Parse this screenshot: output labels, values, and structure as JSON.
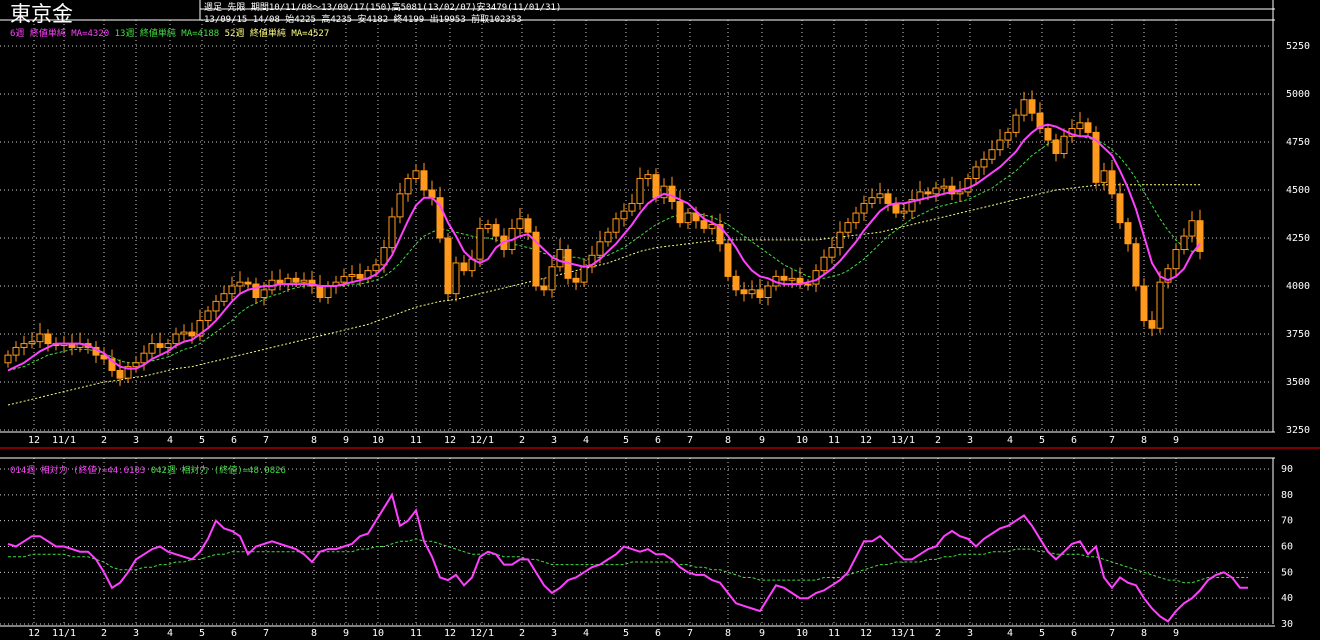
{
  "header": {
    "symbol": "東京金",
    "line1": "週足  先限  期間10/11/08～13/09/17(150)高5081(13/02/07)安3479(11/01/31)",
    "line2": "13/09/15 14/08 始4225 高4235 安4182 終4199 出19953 前取102353"
  },
  "legend_top": [
    {
      "text": "6週 終値単純 MA=4320",
      "color": "#ff40ff"
    },
    {
      "text": "13週 終値単純 MA=4188",
      "color": "#40e040"
    },
    {
      "text": "52週 終値単純 MA=4527",
      "color": "#ffff80"
    }
  ],
  "legend_bottom": [
    {
      "text": "014週 相対力 (終値)=44.6103",
      "color": "#ff40ff"
    },
    {
      "text": "042週 相対力 (終値)=48.0826",
      "color": "#40e040"
    }
  ],
  "colors": {
    "background": "#000000",
    "grid": "#ffffff",
    "candle_up": "#000000",
    "candle_up_border": "#ff9a1c",
    "candle_down": "#ff9a1c",
    "ma6": "#ff40ff",
    "ma13": "#40e040",
    "ma52": "#ffff80",
    "rsi14": "#ff40ff",
    "rsi42": "#40e040",
    "separator": "#ff0000"
  },
  "chart_data": [
    {
      "type": "candlestick",
      "title": "東京金",
      "ylim": [
        3250,
        5250
      ],
      "yticks": [
        3250,
        3500,
        3750,
        4000,
        4250,
        4500,
        4750,
        5000,
        5250
      ],
      "xticks": [
        "12",
        "11/1",
        "2",
        "3",
        "4",
        "5",
        "6",
        "7",
        "8",
        "9",
        "10",
        "11",
        "12",
        "12/1",
        "2",
        "3",
        "4",
        "5",
        "6",
        "7",
        "8",
        "9",
        "10",
        "11",
        "12",
        "13/1",
        "2",
        "3",
        "4",
        "5",
        "6",
        "7",
        "8",
        "9"
      ],
      "n_weeks": 150,
      "close": [
        3640,
        3680,
        3700,
        3710,
        3750,
        3700,
        3690,
        3700,
        3680,
        3700,
        3680,
        3640,
        3620,
        3560,
        3520,
        3580,
        3600,
        3650,
        3700,
        3680,
        3700,
        3750,
        3760,
        3740,
        3820,
        3870,
        3920,
        3960,
        4000,
        4020,
        4010,
        3940,
        3980,
        4030,
        4010,
        4040,
        4020,
        4030,
        4000,
        3940,
        4000,
        4020,
        4050,
        4060,
        4040,
        4080,
        4110,
        4200,
        4360,
        4480,
        4560,
        4600,
        4500,
        4460,
        4250,
        3960,
        4120,
        4080,
        4140,
        4300,
        4320,
        4260,
        4190,
        4300,
        4350,
        4280,
        4000,
        3980,
        4100,
        4190,
        4040,
        4020,
        4100,
        4160,
        4230,
        4280,
        4350,
        4390,
        4430,
        4560,
        4580,
        4460,
        4520,
        4440,
        4330,
        4380,
        4340,
        4300,
        4320,
        4220,
        4050,
        3980,
        3960,
        3980,
        3940,
        4000,
        4050,
        4030,
        4040,
        4010,
        4010,
        4080,
        4150,
        4200,
        4280,
        4330,
        4380,
        4430,
        4460,
        4480,
        4430,
        4380,
        4390,
        4450,
        4490,
        4480,
        4510,
        4520,
        4480,
        4490,
        4560,
        4620,
        4660,
        4710,
        4760,
        4800,
        4890,
        4970,
        4900,
        4820,
        4760,
        4690,
        4780,
        4820,
        4850,
        4800,
        4540,
        4600,
        4480,
        4330,
        4220,
        4000,
        3820,
        3780,
        4020,
        4090,
        4190,
        4260,
        4340,
        4180
      ],
      "ma6": [
        3560,
        3580,
        3600,
        3630,
        3660,
        3680,
        3700,
        3700,
        3700,
        3700,
        3690,
        3670,
        3650,
        3610,
        3580,
        3570,
        3570,
        3590,
        3620,
        3640,
        3660,
        3690,
        3710,
        3720,
        3750,
        3780,
        3820,
        3870,
        3920,
        3960,
        3980,
        3990,
        4000,
        4000,
        4010,
        4010,
        4010,
        4010,
        4010,
        4000,
        4000,
        4000,
        4010,
        4020,
        4030,
        4040,
        4060,
        4100,
        4160,
        4250,
        4340,
        4420,
        4460,
        4460,
        4420,
        4330,
        4260,
        4180,
        4140,
        4120,
        4140,
        4200,
        4230,
        4240,
        4260,
        4270,
        4230,
        4190,
        4150,
        4130,
        4120,
        4110,
        4100,
        4110,
        4140,
        4180,
        4220,
        4270,
        4320,
        4380,
        4430,
        4460,
        4480,
        4470,
        4450,
        4430,
        4390,
        4350,
        4330,
        4310,
        4260,
        4200,
        4130,
        4080,
        4050,
        4040,
        4020,
        4010,
        4010,
        4010,
        4020,
        4030,
        4060,
        4090,
        4130,
        4180,
        4230,
        4290,
        4340,
        4390,
        4420,
        4430,
        4430,
        4440,
        4450,
        4460,
        4470,
        4480,
        4490,
        4500,
        4510,
        4530,
        4560,
        4590,
        4620,
        4660,
        4700,
        4760,
        4800,
        4830,
        4840,
        4830,
        4810,
        4790,
        4780,
        4780,
        4760,
        4720,
        4680,
        4600,
        4510,
        4400,
        4260,
        4120,
        4050,
        4030,
        4050,
        4090,
        4170,
        4220
      ],
      "ma13": [
        3560,
        3570,
        3580,
        3600,
        3620,
        3640,
        3650,
        3660,
        3670,
        3670,
        3670,
        3660,
        3650,
        3630,
        3610,
        3600,
        3600,
        3600,
        3610,
        3620,
        3630,
        3650,
        3670,
        3680,
        3700,
        3730,
        3760,
        3790,
        3820,
        3860,
        3890,
        3910,
        3930,
        3950,
        3960,
        3980,
        3990,
        4000,
        4000,
        4000,
        4000,
        4000,
        4000,
        4010,
        4010,
        4020,
        4030,
        4050,
        4080,
        4120,
        4170,
        4220,
        4260,
        4280,
        4300,
        4290,
        4280,
        4270,
        4260,
        4250,
        4250,
        4240,
        4230,
        4220,
        4210,
        4200,
        4190,
        4170,
        4160,
        4150,
        4150,
        4150,
        4140,
        4140,
        4150,
        4160,
        4180,
        4200,
        4230,
        4260,
        4290,
        4320,
        4340,
        4360,
        4370,
        4380,
        4380,
        4370,
        4360,
        4340,
        4320,
        4290,
        4260,
        4230,
        4200,
        4170,
        4140,
        4110,
        4090,
        4070,
        4050,
        4040,
        4040,
        4050,
        4060,
        4080,
        4110,
        4140,
        4180,
        4220,
        4260,
        4290,
        4320,
        4350,
        4370,
        4390,
        4410,
        4420,
        4430,
        4440,
        4450,
        4470,
        4490,
        4510,
        4540,
        4570,
        4600,
        4640,
        4680,
        4710,
        4740,
        4760,
        4770,
        4780,
        4780,
        4770,
        4760,
        4740,
        4710,
        4670,
        4620,
        4560,
        4490,
        4420,
        4350,
        4290,
        4240,
        4200,
        4180,
        4190
      ],
      "ma52": [
        3380,
        3390,
        3400,
        3410,
        3420,
        3430,
        3440,
        3450,
        3460,
        3470,
        3480,
        3490,
        3500,
        3505,
        3510,
        3520,
        3525,
        3530,
        3540,
        3550,
        3560,
        3570,
        3575,
        3580,
        3590,
        3600,
        3610,
        3620,
        3630,
        3640,
        3650,
        3660,
        3670,
        3680,
        3690,
        3700,
        3710,
        3720,
        3730,
        3740,
        3750,
        3760,
        3770,
        3780,
        3790,
        3800,
        3815,
        3830,
        3845,
        3860,
        3875,
        3890,
        3900,
        3910,
        3920,
        3925,
        3930,
        3940,
        3950,
        3960,
        3970,
        3980,
        3990,
        4000,
        4010,
        4020,
        4030,
        4040,
        4050,
        4060,
        4070,
        4080,
        4090,
        4100,
        4110,
        4120,
        4135,
        4150,
        4165,
        4180,
        4190,
        4200,
        4205,
        4210,
        4215,
        4220,
        4225,
        4230,
        4235,
        4240,
        4240,
        4240,
        4240,
        4240,
        4240,
        4240,
        4240,
        4240,
        4240,
        4240,
        4240,
        4240,
        4245,
        4250,
        4255,
        4260,
        4265,
        4270,
        4275,
        4280,
        4290,
        4300,
        4310,
        4320,
        4330,
        4340,
        4350,
        4360,
        4370,
        4380,
        4390,
        4400,
        4410,
        4420,
        4430,
        4440,
        4450,
        4460,
        4470,
        4480,
        4490,
        4500,
        4505,
        4510,
        4515,
        4520,
        4525,
        4527,
        4527,
        4527,
        4527,
        4527,
        4527,
        4527,
        4527,
        4527,
        4527,
        4527,
        4527,
        4527
      ]
    },
    {
      "type": "line",
      "title": "相対力",
      "ylim": [
        30,
        90
      ],
      "yticks": [
        30,
        40,
        50,
        60,
        70,
        80,
        90
      ],
      "series": [
        {
          "name": "014週 相対力 (終値)",
          "values": [
            61,
            60,
            62,
            64,
            64,
            62,
            60,
            60,
            59,
            58,
            58,
            55,
            50,
            44,
            46,
            50,
            55,
            57,
            59,
            60,
            58,
            57,
            56,
            55,
            58,
            63,
            70,
            67,
            66,
            64,
            57,
            60,
            61,
            62,
            61,
            60,
            59,
            57,
            54,
            58,
            59,
            59,
            60,
            61,
            64,
            65,
            70,
            75,
            80,
            68,
            70,
            74,
            62,
            56,
            48,
            47,
            49,
            45,
            48,
            56,
            58,
            57,
            53,
            53,
            55,
            55,
            50,
            45,
            42,
            44,
            47,
            48,
            50,
            52,
            53,
            55,
            57,
            60,
            59,
            58,
            59,
            57,
            57,
            55,
            52,
            50,
            49,
            49,
            47,
            46,
            42,
            38,
            37,
            36,
            35,
            40,
            45,
            44,
            42,
            40,
            40,
            42,
            43,
            45,
            47,
            50,
            56,
            62,
            62,
            64,
            61,
            58,
            55,
            55,
            57,
            59,
            60,
            64,
            66,
            64,
            63,
            60,
            63,
            65,
            67,
            68,
            70,
            72,
            68,
            63,
            58,
            55,
            58,
            61,
            62,
            57,
            60,
            48,
            44,
            48,
            46,
            45,
            40,
            36,
            33,
            31,
            35,
            38,
            40,
            43,
            47,
            49,
            50,
            48,
            44,
            44
          ]
        },
        {
          "name": "042週 相対力 (終値)",
          "values": [
            56,
            56,
            56,
            57,
            57,
            57,
            57,
            57,
            56,
            56,
            56,
            55,
            54,
            52,
            51,
            51,
            51,
            52,
            52,
            53,
            53,
            54,
            54,
            55,
            55,
            56,
            57,
            57,
            58,
            58,
            58,
            58,
            58,
            58,
            58,
            58,
            58,
            58,
            58,
            58,
            58,
            58,
            58,
            58,
            59,
            59,
            60,
            60,
            61,
            62,
            62,
            63,
            62,
            62,
            61,
            60,
            59,
            58,
            57,
            57,
            57,
            57,
            56,
            56,
            56,
            55,
            55,
            54,
            53,
            53,
            53,
            53,
            53,
            53,
            53,
            53,
            53,
            53,
            54,
            54,
            54,
            54,
            54,
            54,
            53,
            53,
            52,
            52,
            51,
            51,
            50,
            49,
            48,
            48,
            47,
            47,
            47,
            47,
            47,
            47,
            47,
            47,
            48,
            48,
            48,
            49,
            50,
            51,
            52,
            53,
            53,
            54,
            54,
            54,
            54,
            55,
            55,
            56,
            56,
            57,
            57,
            57,
            57,
            58,
            58,
            58,
            59,
            59,
            59,
            58,
            58,
            57,
            57,
            57,
            57,
            56,
            56,
            55,
            54,
            53,
            52,
            51,
            50,
            49,
            48,
            47,
            47,
            46,
            46,
            47,
            48,
            48,
            48,
            48,
            48,
            48
          ]
        }
      ]
    }
  ]
}
